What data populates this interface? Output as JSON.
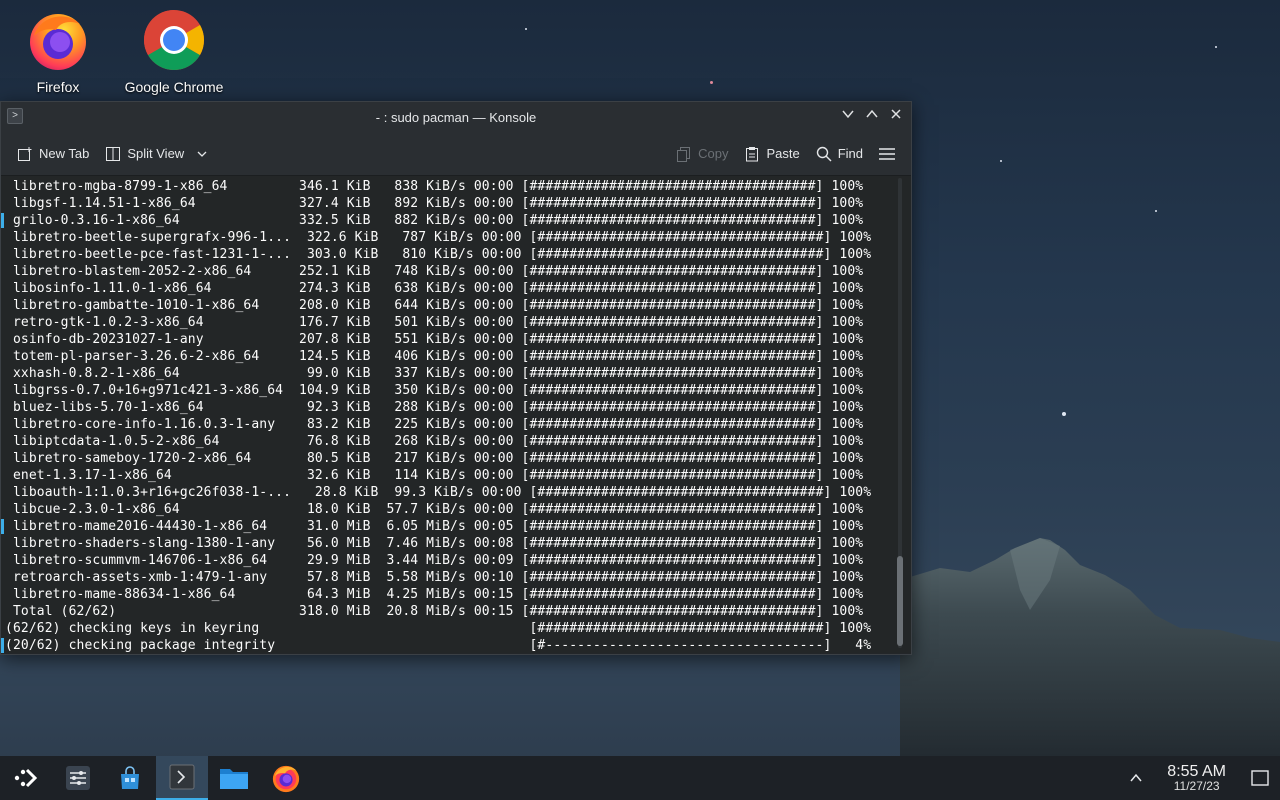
{
  "desktop": {
    "icons": [
      {
        "label": "Firefox"
      },
      {
        "label": "Google Chrome"
      }
    ]
  },
  "window": {
    "title": "- : sudo pacman — Konsole",
    "toolbar": {
      "new_tab": "New Tab",
      "split_view": "Split View",
      "copy": "Copy",
      "paste": "Paste",
      "find": "Find"
    }
  },
  "terminal": {
    "lines": [
      " libretro-mgba-8799-1-x86_64         346.1 KiB   838 KiB/s 00:00 [####################################] 100%",
      " libgsf-1.14.51-1-x86_64             327.4 KiB   892 KiB/s 00:00 [####################################] 100%",
      " grilo-0.3.16-1-x86_64               332.5 KiB   882 KiB/s 00:00 [####################################] 100%",
      " libretro-beetle-supergrafx-996-1...  322.6 KiB   787 KiB/s 00:00 [####################################] 100%",
      " libretro-beetle-pce-fast-1231-1-...  303.0 KiB   810 KiB/s 00:00 [####################################] 100%",
      " libretro-blastem-2052-2-x86_64      252.1 KiB   748 KiB/s 00:00 [####################################] 100%",
      " libosinfo-1.11.0-1-x86_64           274.3 KiB   638 KiB/s 00:00 [####################################] 100%",
      " libretro-gambatte-1010-1-x86_64     208.0 KiB   644 KiB/s 00:00 [####################################] 100%",
      " retro-gtk-1.0.2-3-x86_64            176.7 KiB   501 KiB/s 00:00 [####################################] 100%",
      " osinfo-db-20231027-1-any            207.8 KiB   551 KiB/s 00:00 [####################################] 100%",
      " totem-pl-parser-3.26.6-2-x86_64     124.5 KiB   406 KiB/s 00:00 [####################################] 100%",
      " xxhash-0.8.2-1-x86_64                99.0 KiB   337 KiB/s 00:00 [####################################] 100%",
      " libgrss-0.7.0+16+g971c421-3-x86_64  104.9 KiB   350 KiB/s 00:00 [####################################] 100%",
      " bluez-libs-5.70-1-x86_64             92.3 KiB   288 KiB/s 00:00 [####################################] 100%",
      " libretro-core-info-1.16.0.3-1-any    83.2 KiB   225 KiB/s 00:00 [####################################] 100%",
      " libiptcdata-1.0.5-2-x86_64           76.8 KiB   268 KiB/s 00:00 [####################################] 100%",
      " libretro-sameboy-1720-2-x86_64       80.5 KiB   217 KiB/s 00:00 [####################################] 100%",
      " enet-1.3.17-1-x86_64                 32.6 KiB   114 KiB/s 00:00 [####################################] 100%",
      " liboauth-1:1.0.3+r16+gc26f038-1-...   28.8 KiB  99.3 KiB/s 00:00 [####################################] 100%",
      " libcue-2.3.0-1-x86_64                18.0 KiB  57.7 KiB/s 00:00 [####################################] 100%",
      " libretro-mame2016-44430-1-x86_64     31.0 MiB  6.05 MiB/s 00:05 [####################################] 100%",
      " libretro-shaders-slang-1380-1-any    56.0 MiB  7.46 MiB/s 00:08 [####################################] 100%",
      " libretro-scummvm-146706-1-x86_64     29.9 MiB  3.44 MiB/s 00:09 [####################################] 100%",
      " retroarch-assets-xmb-1:479-1-any     57.8 MiB  5.58 MiB/s 00:10 [####################################] 100%",
      " libretro-mame-88634-1-x86_64         64.3 MiB  4.25 MiB/s 00:15 [####################################] 100%",
      " Total (62/62)                       318.0 MiB  20.8 MiB/s 00:15 [####################################] 100%",
      "(62/62) checking keys in keyring                                  [####################################] 100%",
      "(20/62) checking package integrity                                [#-----------------------------------]   4%"
    ]
  },
  "taskbar": {
    "time": "8:55 AM",
    "date": "11/27/23"
  },
  "colors": {
    "accent": "#3daee9",
    "terminal_bg": "#232627",
    "chrome_bg": "#2a2e32"
  }
}
